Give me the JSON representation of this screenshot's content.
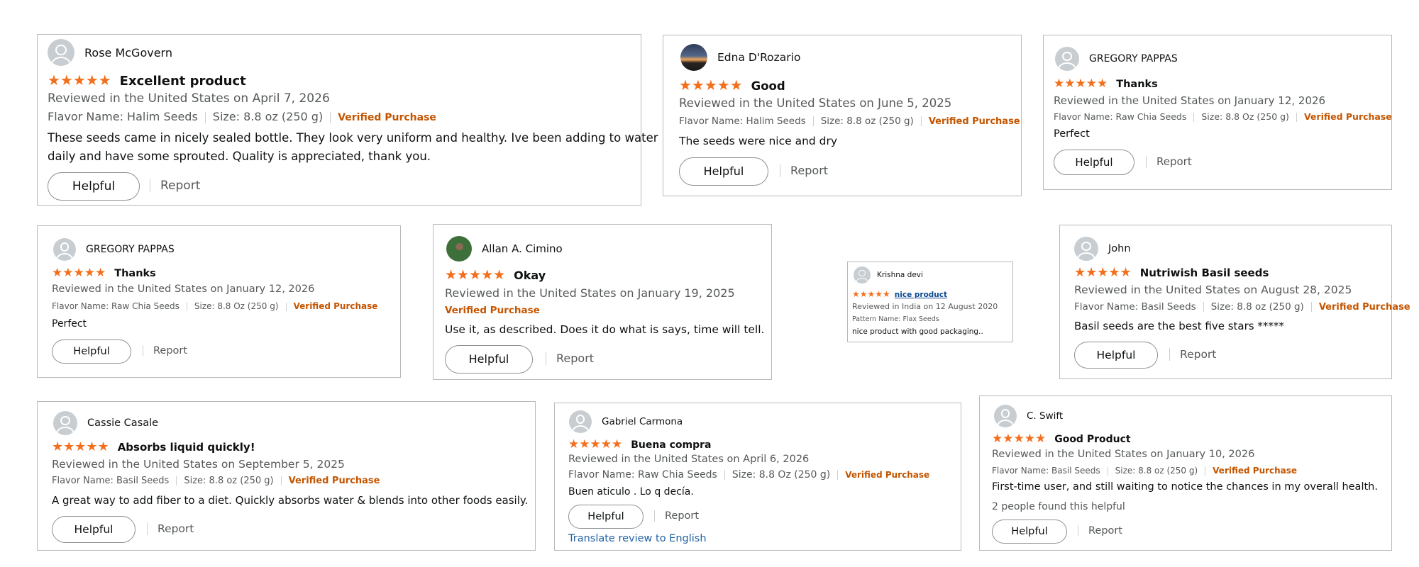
{
  "reviews": [
    {
      "name": "Rose McGovern",
      "stars": "★★★★★",
      "rating": 5,
      "title": "Excellent product",
      "meta": "Reviewed in the United States on April 7, 2026",
      "flavor": "Flavor Name: Halim Seeds",
      "size": "Size: 8.8 oz (250 g)",
      "verified": "Verified Purchase",
      "body_1": "These seeds came in nicely sealed bottle. They look very uniform and healthy. Ive been adding to water",
      "body_2": "daily and have some sprouted. Quality is appreciated, thank you.",
      "helpful": "Helpful",
      "report": "Report"
    },
    {
      "name": "Edna D'Rozario",
      "stars": "★★★★★",
      "rating": 5,
      "title": "Good",
      "meta": "Reviewed in the United States on June 5, 2025",
      "flavor": "Flavor Name: Halim Seeds",
      "size": "Size: 8.8 oz (250 g)",
      "verified": "Verified Purchase",
      "body": "The seeds were nice and dry",
      "helpful": "Helpful",
      "report": "Report"
    },
    {
      "name": "GREGORY PAPPAS",
      "stars": "★★★★★",
      "rating": 5,
      "title": "Thanks",
      "meta": "Reviewed in the United States on January 12, 2026",
      "flavor": "Flavor Name: Raw Chia Seeds",
      "size": "Size: 8.8 Oz (250 g)",
      "verified": "Verified Purchase",
      "body": "Perfect",
      "helpful": "Helpful",
      "report": "Report"
    },
    {
      "name": "GREGORY PAPPAS",
      "stars": "★★★★★",
      "rating": 5,
      "title": "Thanks",
      "meta": "Reviewed in the United States on January 12, 2026",
      "flavor": "Flavor Name: Raw Chia Seeds",
      "size": "Size: 8.8 Oz (250 g)",
      "verified": "Verified Purchase",
      "body": "Perfect",
      "helpful": "Helpful",
      "report": "Report"
    },
    {
      "name": "Allan A. Cimino",
      "stars": "★★★★★",
      "rating": 5,
      "title": "Okay",
      "meta": "Reviewed in the United States on January 19, 2025",
      "verified": "Verified Purchase",
      "body": "Use it, as described. Does it do what is says, time will tell.",
      "helpful": "Helpful",
      "report": "Report"
    },
    {
      "name": "Krishna devi",
      "stars": "★★★★★",
      "rating": 5,
      "title": "nice product",
      "meta": "Reviewed in India on 12 August 2020",
      "pattern": "Pattern Name: Flax Seeds",
      "body": "nice product with good packaging.."
    },
    {
      "name": "John",
      "stars": "★★★★★",
      "rating": 5,
      "title": "Nutriwish Basil seeds",
      "meta": "Reviewed in the United States on August 28, 2025",
      "flavor": "Flavor Name: Basil Seeds",
      "size": "Size: 8.8 oz (250 g)",
      "verified": "Verified Purchase",
      "body": "Basil seeds are the best five stars *****",
      "helpful": "Helpful",
      "report": "Report"
    },
    {
      "name": "Cassie Casale",
      "stars": "★★★★★",
      "rating": 5,
      "title": "Absorbs liquid quickly!",
      "meta": "Reviewed in the United States on September 5, 2025",
      "flavor": "Flavor Name: Basil Seeds",
      "size": "Size: 8.8 oz (250 g)",
      "verified": "Verified Purchase",
      "body": "A great way to add fiber to a diet. Quickly absorbs water & blends into other foods easily.",
      "helpful": "Helpful",
      "report": "Report"
    },
    {
      "name": "Gabriel Carmona",
      "stars": "★★★★★",
      "rating": 5,
      "title": "Buena compra",
      "meta": "Reviewed in the United States on April 6, 2026",
      "flavor": "Flavor Name: Raw Chia Seeds",
      "size": "Size: 8.8 Oz (250 g)",
      "verified": "Verified Purchase",
      "body": "Buen aticulo . Lo q decía.",
      "helpful": "Helpful",
      "report": "Report",
      "translate": "Translate review to English"
    },
    {
      "name": "C. Swift",
      "stars": "★★★★★",
      "rating": 5,
      "title": "Good Product",
      "meta": "Reviewed in the United States on January 10, 2026",
      "flavor": "Flavor Name: Basil Seeds",
      "size": "Size: 8.8 oz (250 g)",
      "verified": "Verified Purchase",
      "body": "First-time user, and still waiting to notice the chances in my overall health.",
      "helpful_count": "2 people found this helpful",
      "helpful": "Helpful",
      "report": "Report"
    }
  ]
}
